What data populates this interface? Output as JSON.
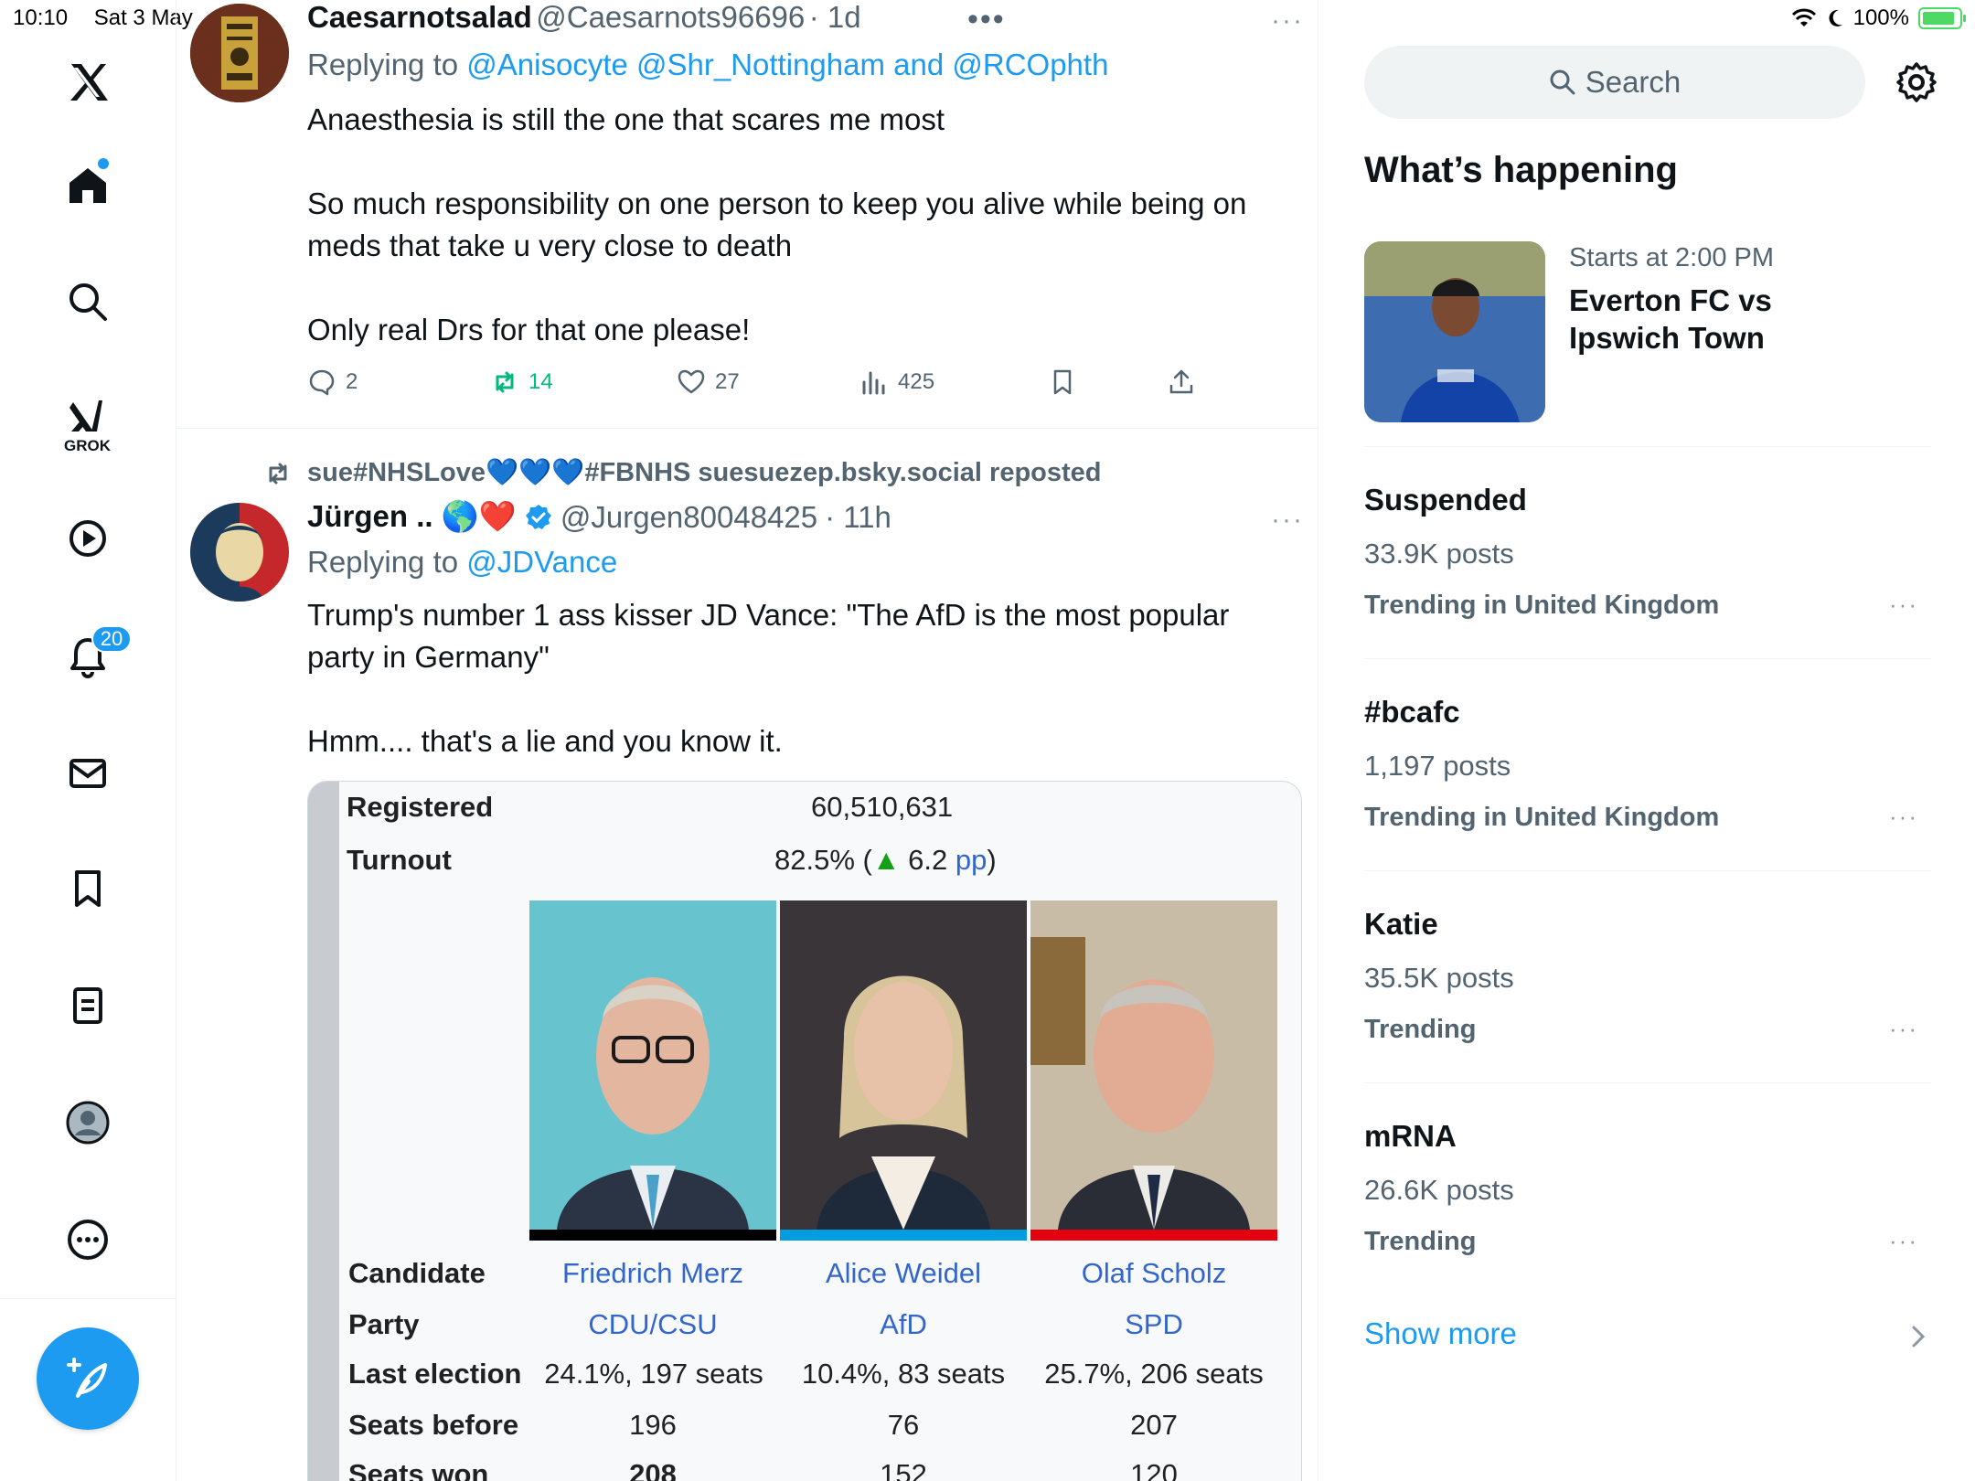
{
  "status": {
    "time": "10:10",
    "date": "Sat 3 May",
    "battery": "100%"
  },
  "nav": {
    "grok_label": "GROK",
    "notifications_count": "20"
  },
  "tweet1": {
    "name": "Caesarnotsalad",
    "handle": "@Caesarnots96696",
    "time": "· 1d",
    "replying_prefix": "Replying to ",
    "replying_to": "@Anisocyte @Shr_Nottingham and @RCOphth",
    "text": "Anaesthesia is still the one that scares me most\n\nSo much responsibility on one person to keep you alive while being on meds that take u very close to death\n\nOnly real Drs for that one please!",
    "replies": "2",
    "reposts": "14",
    "likes": "27",
    "views": "425"
  },
  "tweet2": {
    "repost_by": "sue#NHSLove💙💙💙#FBNHS suesuezep.bsky.social reposted",
    "name": "Jürgen .. 🌎❤️",
    "handle": "@Jurgen80048425",
    "time": "· 11h",
    "replying_prefix": "Replying to ",
    "replying_to": "@JDVance",
    "text": "Trump's number 1 ass kisser JD Vance: \"The AfD is the most popular party in Germany\"\n\nHmm.... that's a lie and you know it.",
    "card": {
      "registered_label": "Registered",
      "registered_value": "60,510,631",
      "turnout_label": "Turnout",
      "turnout_value": "82.5% (",
      "turnout_change": "6.2",
      "turnout_unit": "pp",
      "turnout_close": ")",
      "row_labels": [
        "Candidate",
        "Party",
        "Last election",
        "Seats before",
        "Seats won"
      ],
      "candidates": [
        {
          "name": "Friedrich Merz",
          "party": "CDU/CSU",
          "last_election": "24.1%, 197 seats",
          "seats_before": "196",
          "seats_won": "208",
          "color": "#000000"
        },
        {
          "name": "Alice Weidel",
          "party": "AfD",
          "last_election": "10.4%, 83 seats",
          "seats_before": "76",
          "seats_won": "152",
          "color": "#009ee0"
        },
        {
          "name": "Olaf Scholz",
          "party": "SPD",
          "last_election": "25.7%, 206 seats",
          "seats_before": "207",
          "seats_won": "120",
          "color": "#e3000f"
        }
      ]
    }
  },
  "sidebar": {
    "search_placeholder": "Search",
    "whats_happening": "What’s happening",
    "event": {
      "time": "Starts at 2:00 PM",
      "title": "Everton FC vs\nIpswich Town"
    },
    "trends": [
      {
        "title": "Suspended",
        "posts": "33.9K posts",
        "context": "Trending in United Kingdom"
      },
      {
        "title": "#bcafc",
        "posts": "1,197 posts",
        "context": "Trending in United Kingdom"
      },
      {
        "title": "Katie",
        "posts": "35.5K posts",
        "context": "Trending"
      },
      {
        "title": "mRNA",
        "posts": "26.6K posts",
        "context": "Trending"
      }
    ],
    "show_more": "Show more"
  },
  "colors": {
    "accent": "#1d9bf0",
    "repost_green": "#00ba7c",
    "muted": "#536471"
  }
}
